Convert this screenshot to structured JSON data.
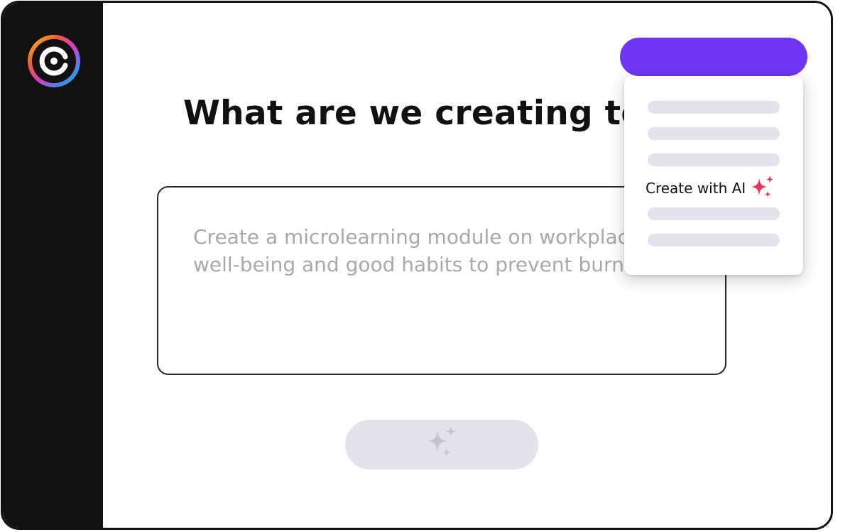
{
  "main": {
    "title": "What are we creating today?",
    "prompt": {
      "placeholder": "Create a microlearning module on workplace\nwell-being and good habits to prevent burnout"
    }
  },
  "dropdown": {
    "ai_option_label": "Create with AI"
  },
  "icons": {
    "logo": "circular-logo-icon",
    "generate": "sparkle-icon",
    "ai_option": "sparkle-icon"
  },
  "colors": {
    "accent": "#6f36f5",
    "sparkle_ai": "#e8345f",
    "sparkle_muted": "#c6c5cf",
    "placeholder_bar": "#e4e3ec",
    "sidebar": "#111111"
  }
}
